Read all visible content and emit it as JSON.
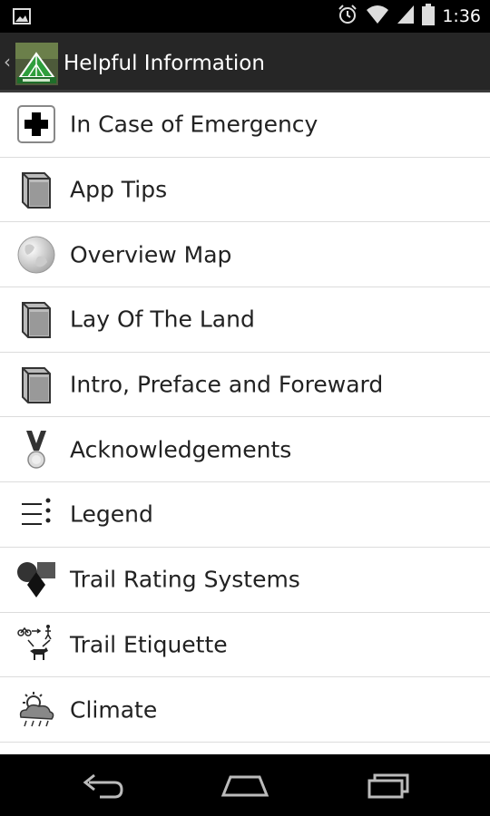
{
  "status_bar": {
    "time": "1:36",
    "icons": [
      "image-notification-icon",
      "alarm-icon",
      "wifi-icon",
      "signal-icon",
      "battery-icon"
    ]
  },
  "action_bar": {
    "title": "Helpful Information",
    "back_icon": "chevron-left-icon",
    "app_icon": "app-logo-icon"
  },
  "list": {
    "items": [
      {
        "label": "In Case of Emergency",
        "icon": "first-aid-cross-icon"
      },
      {
        "label": "App Tips",
        "icon": "book-icon"
      },
      {
        "label": "Overview Map",
        "icon": "globe-icon"
      },
      {
        "label": "Lay Of The Land",
        "icon": "book-icon"
      },
      {
        "label": "Intro, Preface and Foreward",
        "icon": "book-icon"
      },
      {
        "label": "Acknowledgements",
        "icon": "medal-icon"
      },
      {
        "label": "Legend",
        "icon": "legend-list-icon"
      },
      {
        "label": "Trail Rating Systems",
        "icon": "shapes-icon"
      },
      {
        "label": "Trail Etiquette",
        "icon": "trail-users-icon"
      },
      {
        "label": "Climate",
        "icon": "weather-cloud-icon"
      }
    ]
  },
  "nav_bar": {
    "buttons": [
      "back-nav-icon",
      "home-nav-icon",
      "recents-nav-icon"
    ]
  },
  "colors": {
    "status_bar_bg": "#000000",
    "action_bar_bg": "#262626",
    "list_bg": "#ffffff",
    "divider": "#dcdcdc",
    "text": "#222222"
  }
}
